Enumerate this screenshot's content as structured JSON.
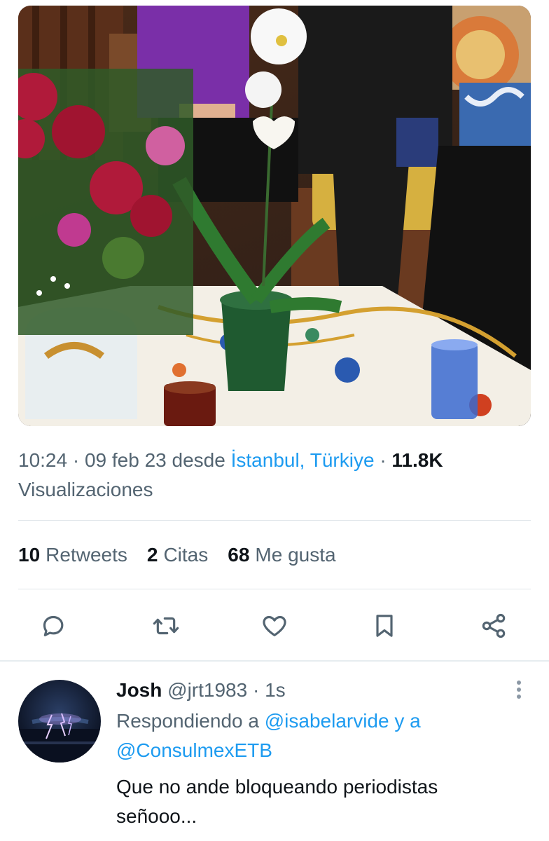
{
  "tweet": {
    "image_alt": "photo",
    "time": "10:24",
    "date": "09 feb 23",
    "from_word": "desde",
    "location": "İstanbul, Türkiye",
    "views_count": "11.8K",
    "views_label": "Visualizaciones",
    "sep": "·"
  },
  "stats": [
    {
      "value": "10",
      "label": "Retweets"
    },
    {
      "value": "2",
      "label": "Citas"
    },
    {
      "value": "68",
      "label": "Me gusta"
    }
  ],
  "actions": [
    "reply-icon",
    "retweet-icon",
    "like-icon",
    "bookmark-icon",
    "share-icon"
  ],
  "reply": {
    "name": "Josh",
    "handle": "@jrt1983",
    "time": "1s",
    "replying_prefix": "Respondiendo a",
    "mention1": "@isabelarvide",
    "and_word": "y a",
    "mention2": "@ConsulmexETB",
    "text": "Que no ande bloqueando periodistas señooo..."
  },
  "colors": {
    "accent": "#1d9bf0",
    "text": "#0f1419",
    "secondary": "#536471"
  }
}
